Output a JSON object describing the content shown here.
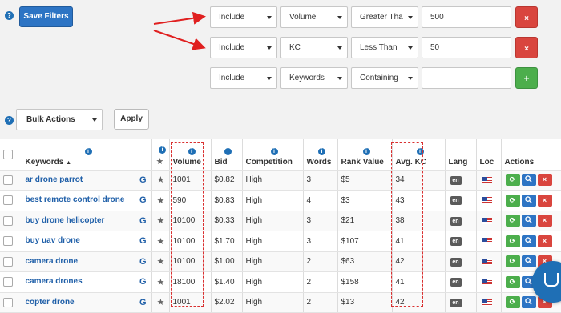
{
  "toolbar": {
    "save_filters_label": "Save Filters",
    "bulk_actions_label": "Bulk Actions",
    "apply_label": "Apply",
    "help_icon": "?"
  },
  "filters": [
    {
      "logic": "Include",
      "field": "Volume",
      "operator": "Greater Tha",
      "value": "500",
      "button": "×"
    },
    {
      "logic": "Include",
      "field": "KC",
      "operator": "Less Than",
      "value": "50",
      "button": "×"
    },
    {
      "logic": "Include",
      "field": "Keywords",
      "operator": "Containing",
      "value": "",
      "button": "+"
    }
  ],
  "table": {
    "headers": {
      "keywords": "Keywords",
      "volume": "Volume",
      "bid": "Bid",
      "competition": "Competition",
      "words": "Words",
      "rank_value": "Rank Value",
      "avg_kc": "Avg. KC",
      "lang": "Lang",
      "loc": "Loc",
      "actions": "Actions",
      "info_glyph": "i",
      "star": "★"
    },
    "rows": [
      {
        "keyword": "ar drone parrot",
        "volume": "1001",
        "bid": "$0.82",
        "competition": "High",
        "words": "3",
        "rank_value": "$5",
        "avg_kc": "34",
        "lang": "en"
      },
      {
        "keyword": "best remote control drone",
        "volume": "590",
        "bid": "$0.83",
        "competition": "High",
        "words": "4",
        "rank_value": "$3",
        "avg_kc": "43",
        "lang": "en"
      },
      {
        "keyword": "buy drone helicopter",
        "volume": "10100",
        "bid": "$0.33",
        "competition": "High",
        "words": "3",
        "rank_value": "$21",
        "avg_kc": "38",
        "lang": "en"
      },
      {
        "keyword": "buy uav drone",
        "volume": "10100",
        "bid": "$1.70",
        "competition": "High",
        "words": "3",
        "rank_value": "$107",
        "avg_kc": "41",
        "lang": "en"
      },
      {
        "keyword": "camera drone",
        "volume": "10100",
        "bid": "$1.00",
        "competition": "High",
        "words": "2",
        "rank_value": "$63",
        "avg_kc": "42",
        "lang": "en"
      },
      {
        "keyword": "camera drones",
        "volume": "18100",
        "bid": "$1.40",
        "competition": "High",
        "words": "2",
        "rank_value": "$158",
        "avg_kc": "41",
        "lang": "en"
      },
      {
        "keyword": "copter drone",
        "volume": "1001",
        "bid": "$2.02",
        "competition": "High",
        "words": "2",
        "rank_value": "$13",
        "avg_kc": "42",
        "lang": "en"
      }
    ]
  },
  "icons": {
    "google": "G",
    "refresh": "⟳",
    "search": "🔍",
    "delete": "×"
  },
  "colors": {
    "primary": "#2d74c4",
    "danger": "#d9453e",
    "success": "#4cae4c",
    "annotation": "#d93030"
  }
}
